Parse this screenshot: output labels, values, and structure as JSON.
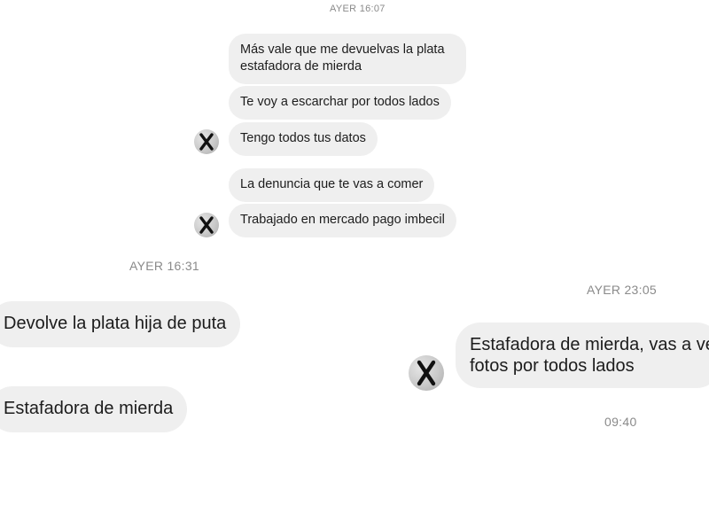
{
  "timestamps": {
    "first": "AYER 16:07",
    "second": "AYER 16:31",
    "third": "AYER 23:05",
    "fourth": "09:40"
  },
  "group_one": {
    "messages": [
      {
        "line1": "Más vale que me devuelvas la plata",
        "line2": "estafadora de mierda"
      },
      {
        "text": "Te voy a escarchar por todos lados"
      },
      {
        "text": "Tengo todos tus datos"
      }
    ]
  },
  "group_two": {
    "messages": [
      {
        "text": "La denuncia que te vas a comer"
      },
      {
        "text": "Trabajado en mercado pago imbecil"
      }
    ]
  },
  "group_three": {
    "messages": [
      {
        "text": "Devolve la plata hija de puta"
      },
      {
        "text": "Estafadora de mierda"
      }
    ]
  },
  "group_four": {
    "message": {
      "line1": "Estafadora de mierda, vas a ver",
      "line2": "fotos por todos lados"
    }
  },
  "avatar": {
    "icon": "blurred-avatar-with-x-icon",
    "mark": "X",
    "colors": {
      "bubble": "#efefef",
      "timestamp": "#8a8a8a",
      "text": "#1c1c1c"
    }
  }
}
